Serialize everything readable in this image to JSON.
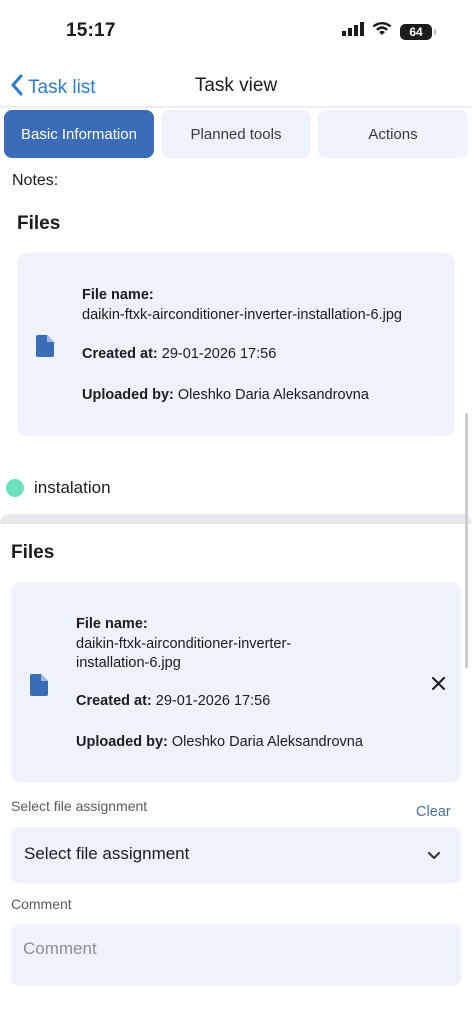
{
  "status_bar": {
    "time": "15:17",
    "battery": "64"
  },
  "nav": {
    "back_label": "Task list",
    "title": "Task view"
  },
  "tabs": [
    {
      "label": "Basic Information",
      "active": true
    },
    {
      "label": "Planned tools",
      "active": false
    },
    {
      "label": "Actions",
      "active": false
    }
  ],
  "notes_label": "Notes:",
  "first_section": {
    "title": "Files",
    "file": {
      "name_label": "File name:",
      "name": "daikin-ftxk-airconditioner-inverter-installation-6.jpg",
      "created_label": "Created at:",
      "created": "29-01-2026 17:56",
      "uploaded_label": "Uploaded by:",
      "uploaded": "Oleshko Daria Aleksandrovna"
    }
  },
  "tag": {
    "label": "instalation",
    "color": "#6fe0bf"
  },
  "second_section": {
    "title": "Files",
    "file": {
      "name_label": "File name:",
      "name_line1": "daikin-ftxk-airconditioner-inverter-",
      "name_line2": "installation-6.jpg",
      "created_label": "Created at:",
      "created": "29-01-2026 17:56",
      "uploaded_label": "Uploaded by:",
      "uploaded": "Oleshko Daria Aleksandrovna"
    }
  },
  "assignment": {
    "label": "Select file assignment",
    "clear": "Clear",
    "value": "Select file assignment"
  },
  "comment": {
    "label": "Comment",
    "placeholder": "Comment"
  },
  "colors": {
    "accent": "#2b7bd6",
    "tab_active": "#3a6cb8",
    "card_bg": "#eef2fb"
  }
}
